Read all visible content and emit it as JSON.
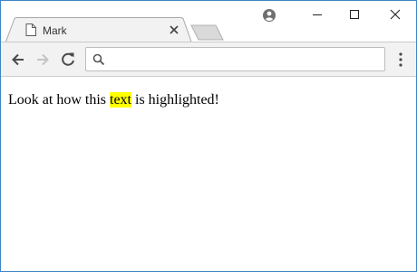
{
  "tab": {
    "title": "Mark",
    "favicon": "page-icon",
    "close_icon": "close-icon"
  },
  "window_controls": {
    "profile_icon": "account-circle-icon",
    "minimize_icon": "minimize-icon",
    "maximize_icon": "maximize-icon",
    "close_icon": "close-icon"
  },
  "toolbar": {
    "back_icon": "arrow-left-icon",
    "forward_icon": "arrow-right-icon",
    "reload_icon": "reload-icon",
    "search_icon": "search-icon",
    "address_value": "",
    "menu_icon": "kebab-menu-icon"
  },
  "page": {
    "text_before": "Look at how this ",
    "highlighted_text": "text",
    "text_after": " is highlighted!",
    "highlight_color": "#ffff00"
  },
  "colors": {
    "window_border": "#3d85c6",
    "toolbar_bg": "#f2f2f2"
  }
}
